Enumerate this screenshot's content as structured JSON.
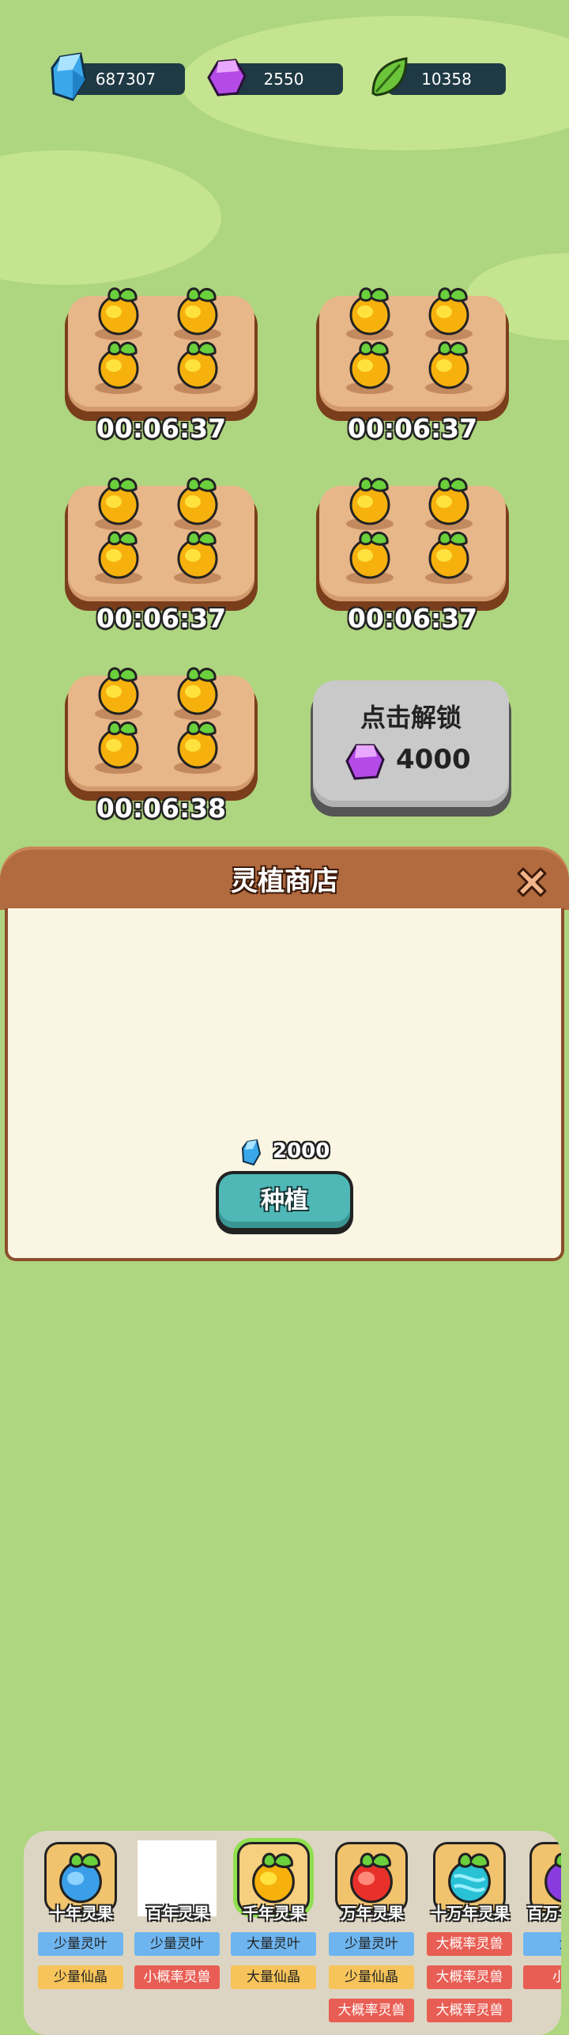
{
  "currencies": [
    {
      "icon": "blue-crystal-icon",
      "value": "687307"
    },
    {
      "icon": "purple-gem-icon",
      "value": "2550"
    },
    {
      "icon": "green-leaf-icon",
      "value": "10358"
    }
  ],
  "plots": [
    {
      "timer": "00:06:37"
    },
    {
      "timer": "00:06:37"
    },
    {
      "timer": "00:06:37"
    },
    {
      "timer": "00:06:37"
    },
    {
      "timer": "00:06:38"
    }
  ],
  "locked_plot": {
    "label": "点击解锁",
    "cost": "4000",
    "cost_icon": "purple-gem-icon"
  },
  "shop": {
    "title": "灵植商店",
    "items": [
      {
        "name": "十年灵果",
        "fruit": "blue",
        "tags": [
          {
            "text": "少量灵叶",
            "color": "blue"
          },
          {
            "text": "少量仙晶",
            "color": "yellow"
          }
        ]
      },
      {
        "name": "百年灵果",
        "fruit": "none",
        "tags": [
          {
            "text": "少量灵叶",
            "color": "blue"
          },
          {
            "text": "小概率灵兽",
            "color": "red"
          }
        ]
      },
      {
        "name": "千年灵果",
        "fruit": "gold",
        "selected": true,
        "tags": [
          {
            "text": "大量灵叶",
            "color": "blue"
          },
          {
            "text": "大量仙晶",
            "color": "yellow"
          }
        ]
      },
      {
        "name": "万年灵果",
        "fruit": "red",
        "tags": [
          {
            "text": "少量灵叶",
            "color": "blue"
          },
          {
            "text": "少量仙晶",
            "color": "yellow"
          },
          {
            "text": "大概率灵兽",
            "color": "red"
          }
        ]
      },
      {
        "name": "十万年灵果",
        "fruit": "cyan",
        "tags": [
          {
            "text": "大概率灵兽",
            "color": "red"
          },
          {
            "text": "大概率灵兽",
            "color": "red"
          },
          {
            "text": "大概率灵兽",
            "color": "red"
          }
        ]
      },
      {
        "name": "百万年灵果",
        "fruit": "purple",
        "tags": [
          {
            "text": "大",
            "color": "blue"
          },
          {
            "text": "小概",
            "color": "red"
          }
        ]
      }
    ],
    "price": "2000",
    "price_icon": "blue-crystal-icon",
    "plant_button": "种植"
  }
}
